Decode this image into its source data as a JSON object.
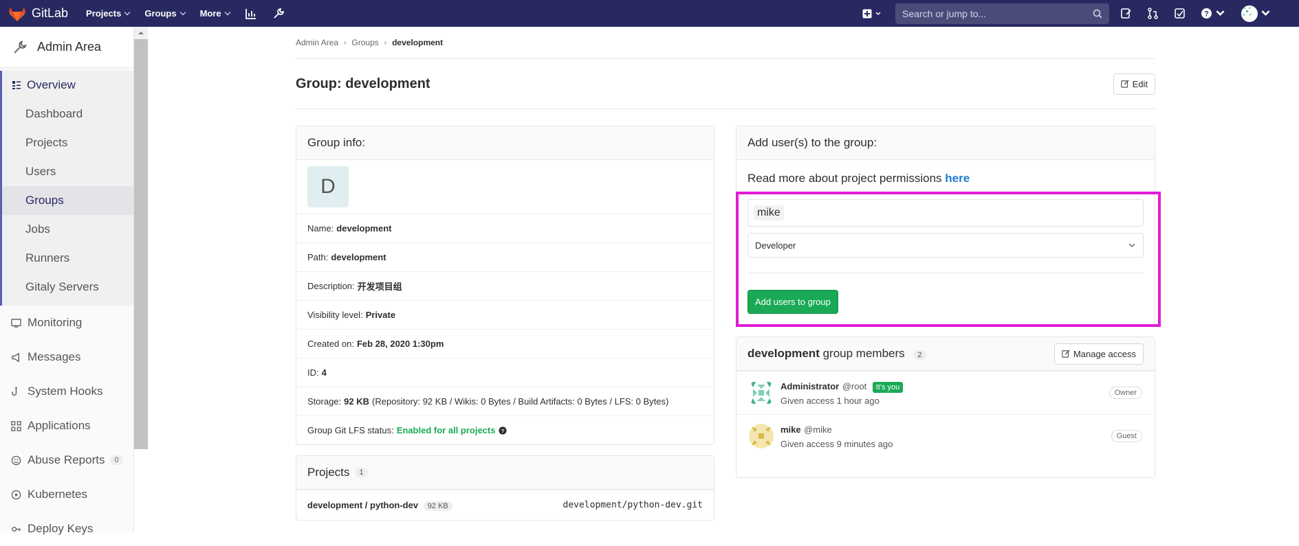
{
  "topbar": {
    "brand": "GitLab",
    "nav": [
      {
        "label": "Projects"
      },
      {
        "label": "Groups"
      },
      {
        "label": "More"
      }
    ],
    "search_placeholder": "Search or jump to..."
  },
  "sidebar": {
    "title": "Admin Area",
    "overview_label": "Overview",
    "sub_items": [
      "Dashboard",
      "Projects",
      "Users",
      "Groups",
      "Jobs",
      "Runners",
      "Gitaly Servers"
    ],
    "items": [
      {
        "label": "Monitoring"
      },
      {
        "label": "Messages"
      },
      {
        "label": "System Hooks"
      },
      {
        "label": "Applications"
      },
      {
        "label": "Abuse Reports",
        "count": "0"
      },
      {
        "label": "Kubernetes"
      },
      {
        "label": "Deploy Keys"
      }
    ]
  },
  "breadcrumb": [
    "Admin Area",
    "Groups",
    "development"
  ],
  "page": {
    "title": "Group: development",
    "edit_label": "Edit"
  },
  "group_info": {
    "header": "Group info:",
    "avatar_letter": "D",
    "rows": [
      {
        "label": "Name:",
        "value": "development"
      },
      {
        "label": "Path:",
        "value": "development"
      },
      {
        "label": "Description:",
        "value": "开发项目组"
      },
      {
        "label": "Visibility level:",
        "value": "Private"
      },
      {
        "label": "Created on:",
        "value": "Feb 28, 2020 1:30pm"
      },
      {
        "label": "ID:",
        "value": "4"
      }
    ],
    "storage_label": "Storage:",
    "storage_value": "92 KB",
    "storage_detail": "(Repository: 92 KB / Wikis: 0 Bytes / Build Artifacts: 0 Bytes / LFS: 0 Bytes)",
    "lfs_label": "Group Git LFS status:",
    "lfs_value": "Enabled for all projects"
  },
  "projects": {
    "header": "Projects",
    "count": "1",
    "items": [
      {
        "name": "development / python-dev",
        "size": "92 KB",
        "path": "development/python-dev.git"
      }
    ]
  },
  "add_users": {
    "header": "Add user(s) to the group:",
    "permissions_text": "Read more about project permissions",
    "permissions_link": "here",
    "token": "mike",
    "role_selected": "Developer",
    "submit_label": "Add users to group"
  },
  "members": {
    "group_name": "development",
    "header_suffix": "group members",
    "count": "2",
    "manage_label": "Manage access",
    "items": [
      {
        "name": "Administrator",
        "handle": "@root",
        "you": "It's you",
        "access": "Given access 1 hour ago",
        "role": "Owner"
      },
      {
        "name": "mike",
        "handle": "@mike",
        "you": "",
        "access": "Given access 9 minutes ago",
        "role": "Guest"
      }
    ]
  },
  "colors": {
    "topbar": "#292961",
    "accent_green": "#1aaa55",
    "highlight": "#e31bd6"
  }
}
